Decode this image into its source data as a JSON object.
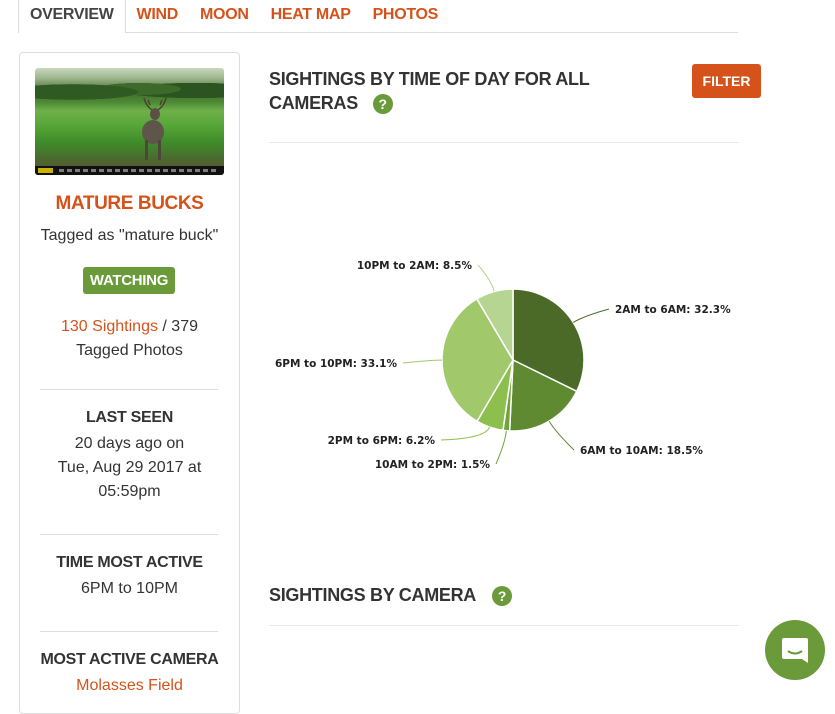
{
  "tabs": [
    {
      "label": "OVERVIEW",
      "active": true
    },
    {
      "label": "WIND",
      "active": false
    },
    {
      "label": "MOON",
      "active": false
    },
    {
      "label": "HEAT MAP",
      "active": false
    },
    {
      "label": "PHOTOS",
      "active": false
    }
  ],
  "profile": {
    "photo_icon": "deer-trail-camera-photo",
    "name": "MATURE BUCKS",
    "tagged_as": "Tagged as \"mature buck\"",
    "watch_label": "WATCHING",
    "sightings_link": "130 Sightings",
    "sightings_rest": " / 379",
    "tagged_photos": "Tagged Photos",
    "last_seen_title": "LAST SEEN",
    "last_seen_line1": "20 days ago on",
    "last_seen_line2": "Tue, Aug 29 2017 at",
    "last_seen_line3": "05:59pm",
    "time_active_title": "TIME MOST ACTIVE",
    "time_active_value": "6PM to 10PM",
    "camera_title": "MOST ACTIVE CAMERA",
    "camera_value": "Molasses Field"
  },
  "sections": {
    "time_of_day_title_line1": "SIGHTINGS BY TIME OF DAY FOR ALL",
    "time_of_day_title_line2": "CAMERAS",
    "help_label": "?",
    "filter_label": "FILTER",
    "by_camera_title": "SIGHTINGS BY CAMERA"
  },
  "colors": {
    "accent": "#d5531b",
    "green": "#6a9a3a"
  },
  "chart_data": {
    "type": "pie",
    "title": "SIGHTINGS BY TIME OF DAY FOR ALL CAMERAS",
    "unit": "%",
    "slices": [
      {
        "label": "2AM to 6AM",
        "value": 32.3,
        "color": "#4b6a27"
      },
      {
        "label": "6AM to 10AM",
        "value": 18.5,
        "color": "#5f8a32"
      },
      {
        "label": "10AM to 2PM",
        "value": 1.5,
        "color": "#72a23c"
      },
      {
        "label": "2PM to 6PM",
        "value": 6.2,
        "color": "#8cbf4e"
      },
      {
        "label": "6PM to 10PM",
        "value": 33.1,
        "color": "#a2c86c"
      },
      {
        "label": "10PM to 2AM",
        "value": 8.5,
        "color": "#b6d592"
      }
    ]
  }
}
